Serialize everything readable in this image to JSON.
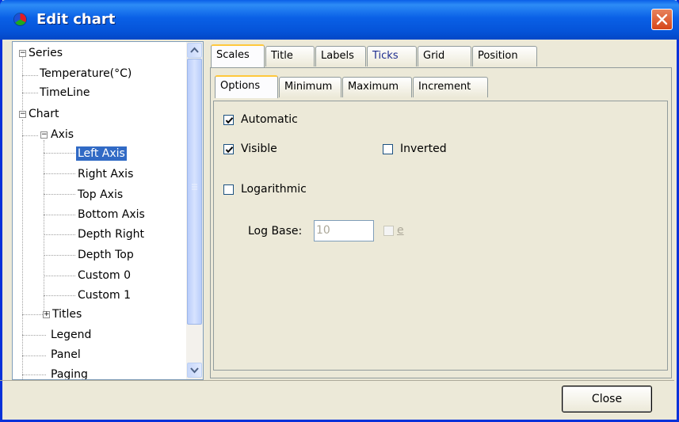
{
  "window": {
    "title": "Edit chart"
  },
  "tree": {
    "items": [
      {
        "label": "Series"
      },
      {
        "label": "Temperature(°C)"
      },
      {
        "label": "TimeLine"
      },
      {
        "label": "Chart"
      },
      {
        "label": "Axis"
      },
      {
        "label": "Left Axis"
      },
      {
        "label": "Right Axis"
      },
      {
        "label": "Top Axis"
      },
      {
        "label": "Bottom Axis"
      },
      {
        "label": "Depth Right"
      },
      {
        "label": "Depth Top"
      },
      {
        "label": "Custom 0"
      },
      {
        "label": "Custom 1"
      },
      {
        "label": "Titles"
      },
      {
        "label": "Legend"
      },
      {
        "label": "Panel"
      },
      {
        "label": "Paging"
      }
    ],
    "selected": "Left Axis"
  },
  "tabs": [
    "Scales",
    "Title",
    "Labels",
    "Ticks",
    "Grid",
    "Position"
  ],
  "active_tab": "Scales",
  "subtabs": [
    "Options",
    "Minimum",
    "Maximum",
    "Increment"
  ],
  "active_subtab": "Options",
  "options": {
    "automatic": {
      "label": "Automatic",
      "checked": true
    },
    "visible": {
      "label": "Visible",
      "checked": true
    },
    "inverted": {
      "label": "Inverted",
      "checked": false
    },
    "logarithmic": {
      "label": "Logarithmic",
      "checked": false
    },
    "log_base_label": "Log Base:",
    "log_base_value": "10",
    "e_label": "e"
  },
  "buttons": {
    "close": "Close"
  }
}
